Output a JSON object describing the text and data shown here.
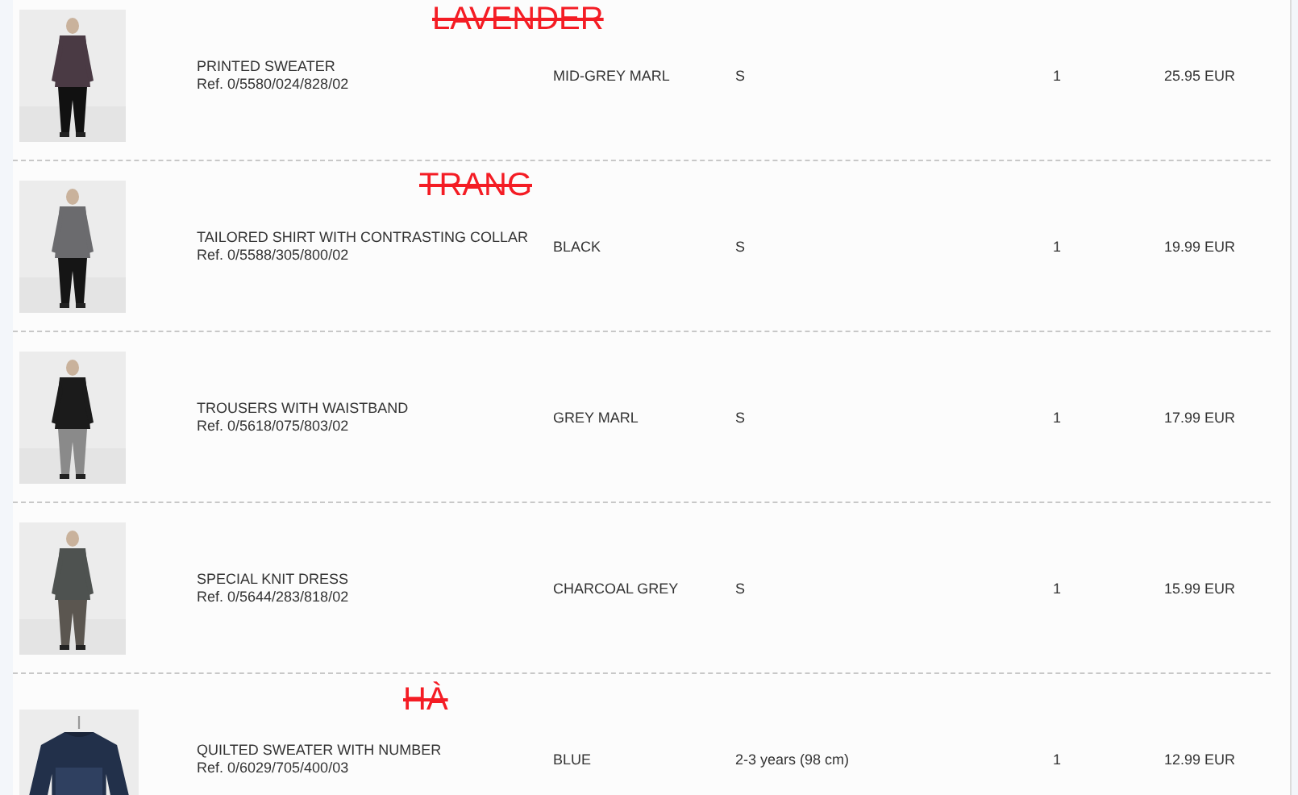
{
  "order_items": [
    {
      "annotation": "LAVENDER",
      "name": "PRINTED SWEATER",
      "ref": "Ref. 0/5580/024/828/02",
      "colour": "MID-GREY MARL",
      "size": "S",
      "quantity": "1",
      "price": "25.95 EUR"
    },
    {
      "annotation": "TRANG",
      "name": "TAILORED SHIRT WITH CONTRASTING COLLAR",
      "ref": "Ref. 0/5588/305/800/02",
      "colour": "BLACK",
      "size": "S",
      "quantity": "1",
      "price": "19.99 EUR"
    },
    {
      "name": "TROUSERS WITH WAISTBAND",
      "ref": "Ref. 0/5618/075/803/02",
      "colour": "GREY MARL",
      "size": "S",
      "quantity": "1",
      "price": "17.99 EUR"
    },
    {
      "name": "SPECIAL KNIT DRESS",
      "ref": "Ref. 0/5644/283/818/02",
      "colour": "CHARCOAL GREY",
      "size": "S",
      "quantity": "1",
      "price": "15.99 EUR"
    },
    {
      "annotation": "HÀ",
      "name": "QUILTED SWEATER WITH NUMBER",
      "ref": "Ref. 0/6029/705/400/03",
      "colour": "BLUE",
      "size": "2-3 years (98 cm)",
      "quantity": "1",
      "price": "12.99 EUR"
    }
  ]
}
